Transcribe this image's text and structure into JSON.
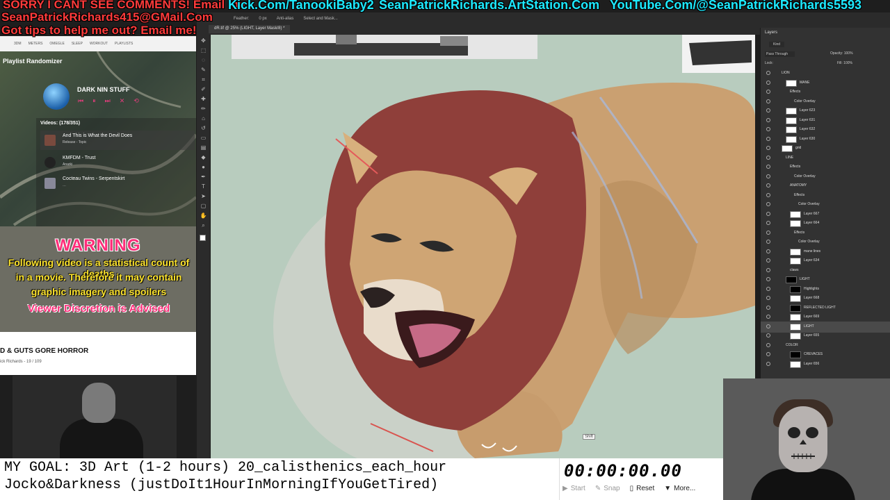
{
  "banner": {
    "line1_red": "SORRY I CANT SEE COMMENTS! Email me:",
    "line1_cyan1": "Kick.Com/TanookiBaby2",
    "line1_cyan2": "SeanPatrickRichards.ArtStation.Com",
    "line1_cyan3": "YouTube.Com/@SeanPatrickRichards5593",
    "line2_red": "SeanPatrickRichards415@GMail.Com",
    "line3_red": "Got tips to help me out? Email me!"
  },
  "photoshop": {
    "doc_tab": "dR.tif @ 25% (LIGHT, Layer Mask/8) *",
    "options": [
      "Feather:",
      "0 px",
      "Anti-alias",
      "Select and Mask..."
    ],
    "layers_tab": "Layers",
    "layers_kind": "Kind",
    "blend_mode": "Pass Through",
    "opacity_label": "Opacity:",
    "opacity_value": "100%",
    "lock_label": "Lock:",
    "fill_label": "Fill:",
    "fill_value": "100%",
    "layers": [
      {
        "name": "LION",
        "thumb": "none",
        "indent": 0
      },
      {
        "name": "MANE",
        "thumb": "white",
        "indent": 1
      },
      {
        "name": "Effects",
        "thumb": "none",
        "indent": 2
      },
      {
        "name": "Color Overlay",
        "thumb": "none",
        "indent": 3
      },
      {
        "name": "Layer 623",
        "thumb": "white",
        "indent": 1
      },
      {
        "name": "Layer 631",
        "thumb": "white",
        "indent": 1
      },
      {
        "name": "Layer 632",
        "thumb": "white",
        "indent": 1
      },
      {
        "name": "Layer 630",
        "thumb": "white",
        "indent": 1
      },
      {
        "name": "grid",
        "thumb": "white",
        "indent": 0
      },
      {
        "name": "LINE",
        "thumb": "none",
        "indent": 1
      },
      {
        "name": "Effects",
        "thumb": "none",
        "indent": 2
      },
      {
        "name": "Color Overlay",
        "thumb": "none",
        "indent": 3
      },
      {
        "name": "ANATOMY",
        "thumb": "none",
        "indent": 2
      },
      {
        "name": "Effects",
        "thumb": "none",
        "indent": 3
      },
      {
        "name": "Color Overlay",
        "thumb": "none",
        "indent": 4
      },
      {
        "name": "Layer 667",
        "thumb": "white",
        "indent": 2
      },
      {
        "name": "Layer 664",
        "thumb": "white",
        "indent": 2
      },
      {
        "name": "Effects",
        "thumb": "none",
        "indent": 3
      },
      {
        "name": "Color Overlay",
        "thumb": "none",
        "indent": 4
      },
      {
        "name": "mane lines",
        "thumb": "white",
        "indent": 2
      },
      {
        "name": "Layer 634",
        "thumb": "white",
        "indent": 2
      },
      {
        "name": "claws",
        "thumb": "none",
        "indent": 2
      },
      {
        "name": "LIGHT",
        "thumb": "black",
        "indent": 1
      },
      {
        "name": "Highlights",
        "thumb": "black",
        "indent": 2
      },
      {
        "name": "Layer 668",
        "thumb": "white",
        "indent": 2
      },
      {
        "name": "REFLECTED LIGHT",
        "thumb": "black",
        "indent": 2
      },
      {
        "name": "Layer 669",
        "thumb": "white",
        "indent": 2
      },
      {
        "name": "LIGHT",
        "thumb": "white",
        "indent": 2,
        "selected": true
      },
      {
        "name": "Layer 655",
        "thumb": "white",
        "indent": 2
      },
      {
        "name": "COLOR",
        "thumb": "none",
        "indent": 1
      },
      {
        "name": "CREVACES",
        "thumb": "black",
        "indent": 2
      },
      {
        "name": "Layer 656",
        "thumb": "white",
        "indent": 2
      }
    ]
  },
  "browser": {
    "bookmarks": [
      "3DM",
      "METERS",
      "OMEGLE",
      "SLEEP",
      "WORKOUT",
      "PLAYLISTS"
    ]
  },
  "playlist": {
    "title": "Playlist Randomizer",
    "artist": "DARK NIN STUFF",
    "videos_header": "Videos: (178/351)",
    "items": [
      {
        "title": "And This is What the Devil Does",
        "sub": "Release - Topic"
      },
      {
        "title": "KMFDM - Trust",
        "sub": "Anarki"
      },
      {
        "title": "Cocteau Twins - Serpentskirt",
        "sub": "…"
      }
    ]
  },
  "warning": {
    "title": "WARNING",
    "line1": "Following video is a statistical count of deaths",
    "line2": "in a movie. Therefore it may contain",
    "line3": "graphic imagery and spoilers",
    "line4": "Viewer Discretion is Advised"
  },
  "youtube": {
    "title": "D & GUTS GORE HORROR",
    "sub": "ick Richards - 19 / 109"
  },
  "goal": {
    "line1": "MY GOAL: 3D Art (1-2 hours) 20_calisthenics_each_hour",
    "line2": "Jocko&Darkness (justDoIt1HourInMorningIfYouGetTired)"
  },
  "stopwatch": {
    "time": "00:00:00.00",
    "start": "Start",
    "snap": "Snap",
    "reset": "Reset",
    "more": "More..."
  },
  "canvas": {
    "badge": "Shift"
  }
}
